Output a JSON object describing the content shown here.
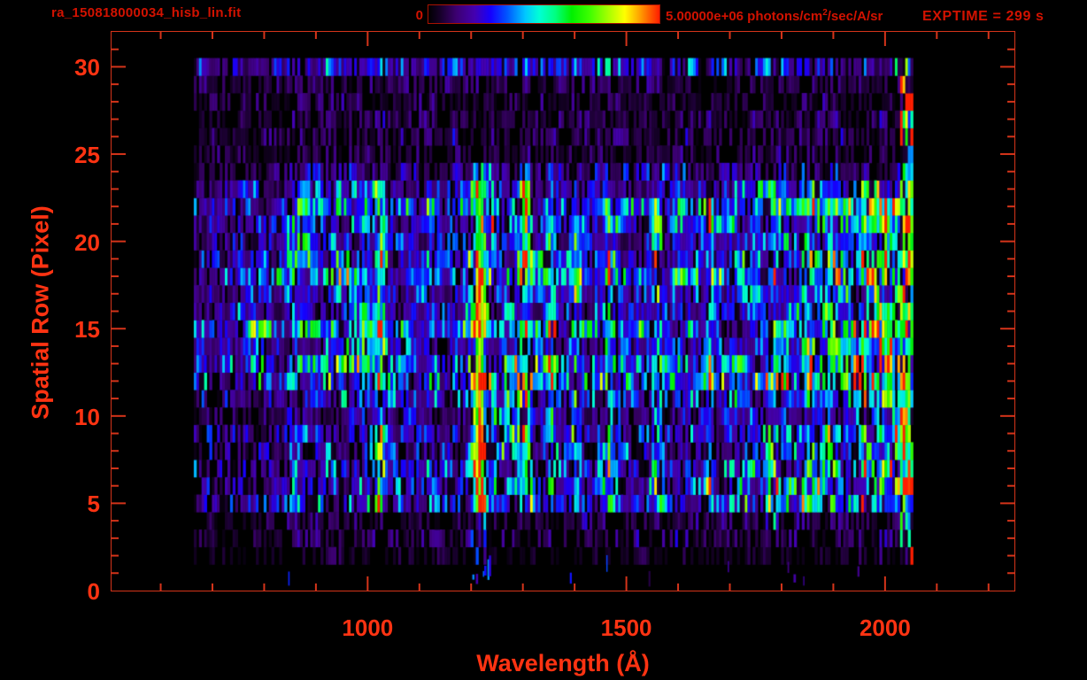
{
  "header": {
    "title": "ra_150818000034_hisb_lin.fit",
    "exptime": "EXPTIME = 299 s",
    "colorbar": {
      "min_label": "0",
      "max_value": "5.00000e+06",
      "units_pre": " photons/cm",
      "units_sup": "2",
      "units_post": "/sec/A/sr"
    }
  },
  "colors": {
    "background": "#000000",
    "frame": "#d5341a",
    "tick_labels": "#ff3312",
    "header_text": "#d21200"
  },
  "chart_data": {
    "type": "heatmap",
    "title": "ra_150818000034_hisb_lin.fit",
    "xlabel": "Wavelength (Å)",
    "ylabel": "Spatial Row (Pixel)",
    "xlim": [
      505,
      2250
    ],
    "ylim": [
      0,
      32
    ],
    "x_ticks": {
      "minor_start": 600,
      "minor_end": 2200,
      "minor_step": 100,
      "major_values": [
        1000,
        1500,
        2000
      ],
      "labels": [
        {
          "value": 1000,
          "label": "1000"
        },
        {
          "value": 1500,
          "label": "1500"
        },
        {
          "value": 2000,
          "label": "2000"
        }
      ]
    },
    "y_ticks": {
      "minor_start": 1,
      "minor_end": 31,
      "minor_step": 1,
      "major_values": [
        0,
        5,
        10,
        15,
        20,
        25,
        30
      ],
      "labels": [
        {
          "value": 0,
          "label": "0"
        },
        {
          "value": 5,
          "label": "5"
        },
        {
          "value": 10,
          "label": "10"
        },
        {
          "value": 15,
          "label": "15"
        },
        {
          "value": 20,
          "label": "20"
        },
        {
          "value": 25,
          "label": "25"
        },
        {
          "value": 30,
          "label": "30"
        }
      ]
    },
    "colorbar": {
      "min": 0,
      "max": 5000000,
      "max_label": "5.00000e+06 photons/cm2/sec/A/sr",
      "stops": [
        [
          0.0,
          "#000000"
        ],
        [
          0.05,
          "#160028"
        ],
        [
          0.12,
          "#3c0070"
        ],
        [
          0.2,
          "#4400b0"
        ],
        [
          0.27,
          "#1500ff"
        ],
        [
          0.34,
          "#0055ff"
        ],
        [
          0.42,
          "#00c8ff"
        ],
        [
          0.48,
          "#00ffd5"
        ],
        [
          0.55,
          "#00ff80"
        ],
        [
          0.62,
          "#00f000"
        ],
        [
          0.7,
          "#40ff00"
        ],
        [
          0.78,
          "#a8ff00"
        ],
        [
          0.85,
          "#ffff00"
        ],
        [
          0.91,
          "#ffa800"
        ],
        [
          0.96,
          "#ff5a00"
        ],
        [
          1.0,
          "#ff1e00"
        ]
      ]
    },
    "exposure_time_s": 299,
    "data_extent": {
      "wavelength_min": 664,
      "wavelength_max": 2052,
      "row_min": 0,
      "row_max": 30.5
    },
    "bin_width_angstrom": 5,
    "texture_seed": 42,
    "row_bands": [
      {
        "row_min": 0,
        "row_max": 1,
        "level": 0.02,
        "gap": 0.95
      },
      {
        "row_min": 2,
        "row_max": 2,
        "level": 0.07,
        "gap": 0.6
      },
      {
        "row_min": 3,
        "row_max": 4,
        "level": 0.1,
        "gap": 0.5
      },
      {
        "row_min": 5,
        "row_max": 11,
        "level": 0.27,
        "gap": 0.25
      },
      {
        "row_min": 12,
        "row_max": 23,
        "level": 0.31,
        "gap": 0.16
      },
      {
        "row_min": 24,
        "row_max": 24,
        "level": 0.16,
        "gap": 0.35
      },
      {
        "row_min": 25,
        "row_max": 29,
        "level": 0.12,
        "gap": 0.45
      },
      {
        "row_min": 30,
        "row_max": 30,
        "level": 0.22,
        "gap": 0.25
      }
    ],
    "emission_lines": [
      {
        "wavelength": 1025,
        "sigma": 7,
        "segments": [
          [
            5,
            23,
            0.42
          ]
        ]
      },
      {
        "wavelength": 1216,
        "sigma": 9,
        "segments": [
          [
            0,
            1,
            0.1
          ],
          [
            2,
            4,
            0.3
          ],
          [
            5,
            11,
            1.0
          ],
          [
            12,
            19,
            0.95
          ],
          [
            20,
            23,
            0.72
          ],
          [
            24,
            24,
            0.55
          ]
        ]
      },
      {
        "wavelength": 1304,
        "sigma": 8,
        "segments": [
          [
            5,
            23,
            0.5
          ]
        ]
      },
      {
        "wavelength": 1356,
        "sigma": 7,
        "segments": [
          [
            5,
            22,
            0.3
          ]
        ]
      },
      {
        "wavelength": 1402,
        "sigma": 7,
        "segments": [
          [
            5,
            21,
            0.26
          ]
        ]
      },
      {
        "wavelength": 1470,
        "sigma": 7,
        "segments": [
          [
            5,
            21,
            0.24
          ]
        ]
      },
      {
        "wavelength": 1560,
        "sigma": 8,
        "segments": [
          [
            5,
            22,
            0.3
          ]
        ]
      },
      {
        "wavelength": 1662,
        "sigma": 7,
        "segments": [
          [
            5,
            22,
            0.22
          ]
        ]
      },
      {
        "wavelength": 1780,
        "sigma": 8,
        "segments": [
          [
            4,
            13,
            0.3
          ]
        ]
      }
    ],
    "continuum_patches": [
      {
        "wavelength": 780,
        "row": 15,
        "amp": 0.32,
        "sw": 18,
        "sr": 1.6
      },
      {
        "wavelength": 845,
        "row": 19,
        "amp": 0.32,
        "sw": 15,
        "sr": 1.4
      },
      {
        "wavelength": 880,
        "row": 20.5,
        "amp": 0.28,
        "sw": 12,
        "sr": 1.2
      },
      {
        "wavelength": 915,
        "row": 21.5,
        "amp": 0.26,
        "sw": 12,
        "sr": 1.2
      },
      {
        "wavelength": 955,
        "row": 16,
        "amp": 0.28,
        "sw": 15,
        "sr": 1.5
      },
      {
        "wavelength": 995,
        "row": 13.5,
        "amp": 0.3,
        "sw": 14,
        "sr": 1.6
      },
      {
        "wavelength": 1245,
        "row": 9.5,
        "amp": 0.32,
        "sw": 20,
        "sr": 1.8
      },
      {
        "wavelength": 1290,
        "row": 11,
        "amp": 0.28,
        "sw": 15,
        "sr": 1.5
      },
      {
        "wavelength": 1235,
        "row": 21,
        "amp": 0.28,
        "sw": 14,
        "sr": 1.5
      }
    ],
    "green_region": {
      "wavelength_start": 1650,
      "wavelength_full": 2010,
      "row_min": 5,
      "row_max": 23,
      "boost": 1.0
    },
    "bright_streak": {
      "wavelength_start": 1670,
      "row_min": 12,
      "row_max": 14,
      "peak_row": 13,
      "amplitude": 0.8
    },
    "right_edge_column": {
      "wavelength_min": 2028,
      "wavelength_max": 2052,
      "row_min": 2,
      "row_max": 30,
      "level": 0.85
    }
  }
}
